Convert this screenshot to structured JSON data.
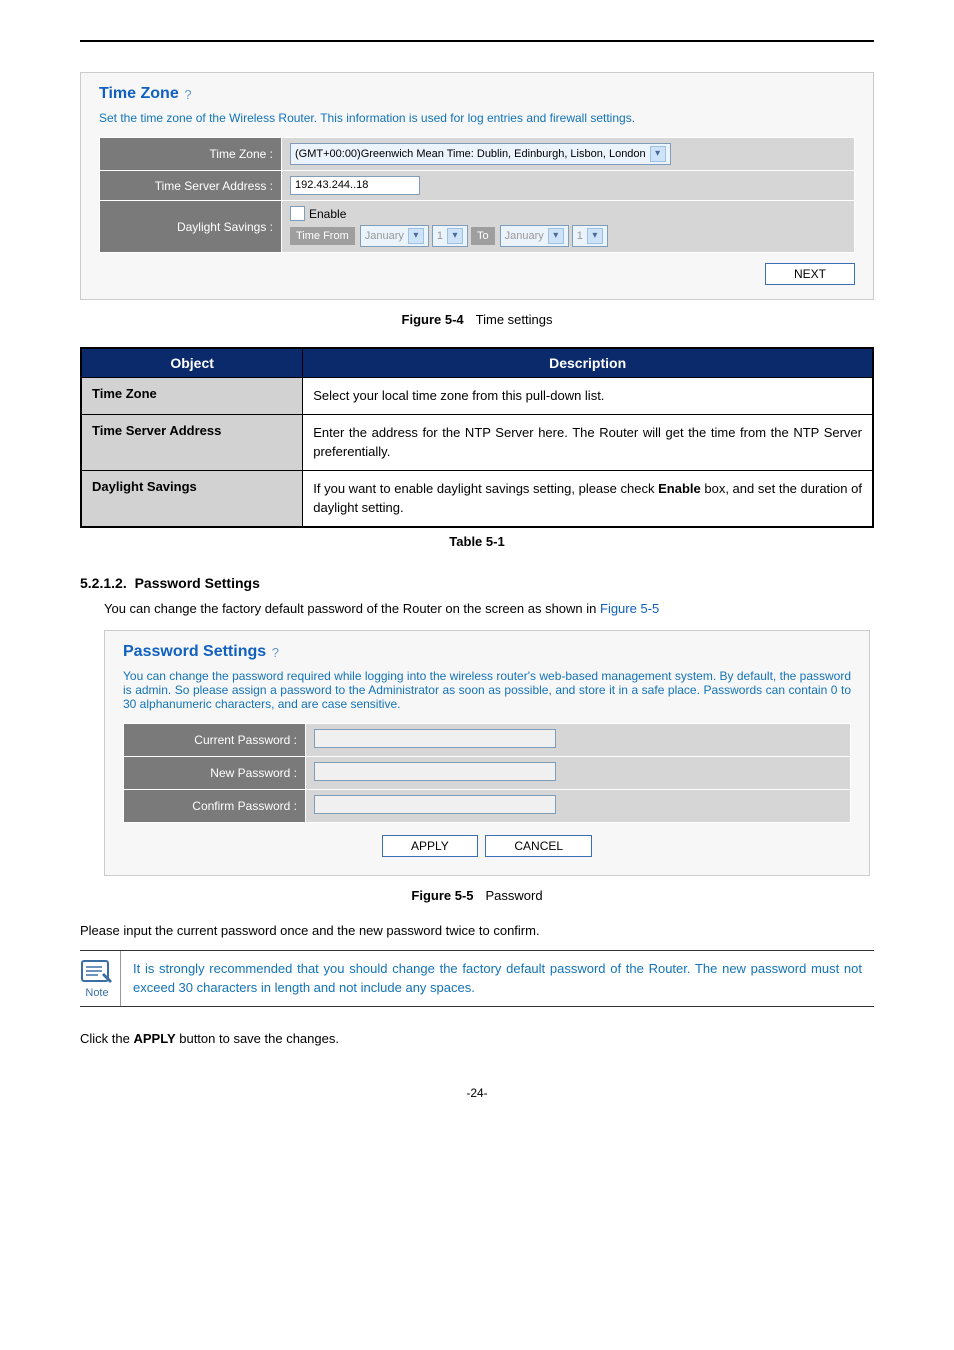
{
  "figure1": {
    "panel_title": "Time Zone",
    "description": "Set the time zone of the Wireless Router. This information is used for log entries and firewall settings.",
    "rows": {
      "tz_label": "Time Zone :",
      "tz_value": "(GMT+00:00)Greenwich Mean Time: Dublin, Edinburgh, Lisbon, London",
      "server_label": "Time Server Address :",
      "server_value": "192.43.244..18",
      "ds_label": "Daylight Savings :",
      "enable": "Enable",
      "time_from": "Time From",
      "january": "January",
      "one": "1",
      "to": "To"
    },
    "next": "NEXT",
    "caption_bold": "Figure 5-4",
    "caption_text": "Time settings"
  },
  "objtable": {
    "h_object": "Object",
    "h_desc": "Description",
    "r1_obj": "Time Zone",
    "r1_desc": "Select your local time zone from this pull-down list.",
    "r2_obj": "Time Server Address",
    "r2_desc": "Enter the address for the NTP Server here. The Router will get the time from the NTP Server preferentially.",
    "r3_obj": "Daylight Savings",
    "r3_desc_pre": "If you want to enable daylight savings setting, please check ",
    "r3_desc_bold": "Enable",
    "r3_desc_post": " box, and set the duration of daylight setting.",
    "caption": "Table 5-1"
  },
  "section": {
    "num": "5.2.1.2.",
    "title": "Password Settings",
    "body_pre": "You can change the factory default password of the Router on the screen as shown in ",
    "body_link": "Figure 5-5"
  },
  "figure2": {
    "panel_title": "Password Settings",
    "desc": "You can change the password required while logging into the wireless router's web-based management system. By default, the password is admin. So please assign a password to the Administrator as soon as possible, and store it in a safe place. Passwords can contain 0 to 30 alphanumeric characters, and are case sensitive.",
    "cur_label": "Current Password :",
    "new_label": "New Password :",
    "conf_label": "Confirm Password :",
    "apply": "APPLY",
    "cancel": "CANCEL",
    "caption_bold": "Figure 5-5",
    "caption_text": "Password"
  },
  "confirm_text": "Please input the current password once and the new password twice to confirm.",
  "note": {
    "label": "Note",
    "text": "It is strongly recommended that you should change the factory default password of the Router. The new password must not exceed 30 characters in length and not include any spaces."
  },
  "apply_text_pre": "Click the ",
  "apply_text_bold": "APPLY",
  "apply_text_post": " button to save the changes.",
  "page_num": "-24-"
}
